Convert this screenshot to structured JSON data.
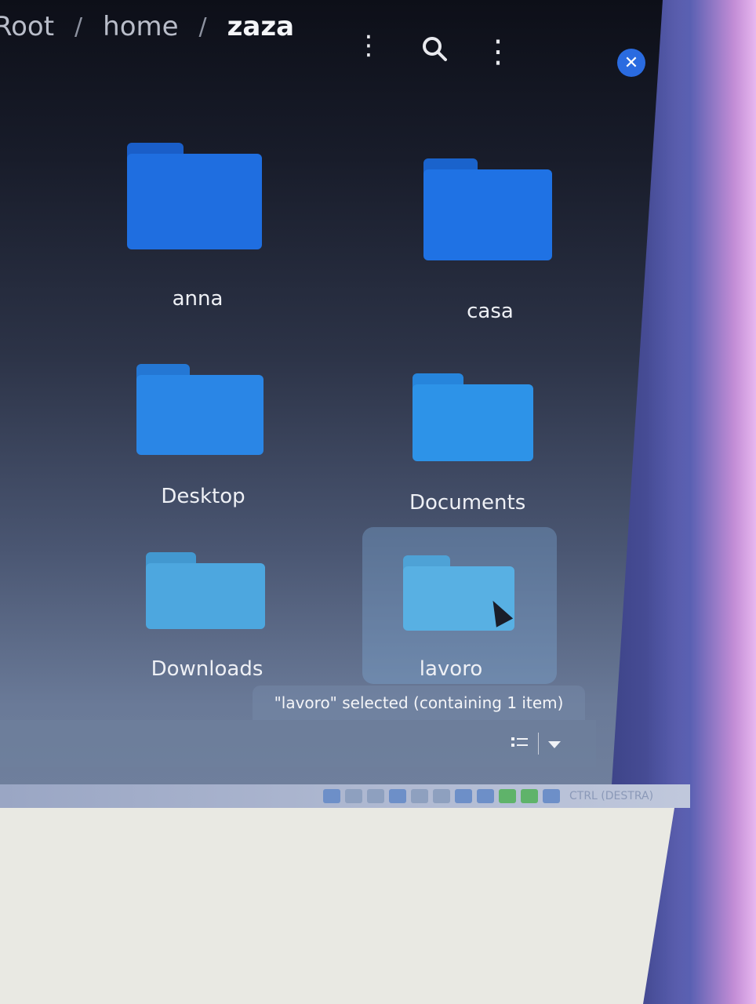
{
  "breadcrumb": {
    "root": "Root",
    "home": "home",
    "current": "zaza",
    "separator": "/"
  },
  "header": {
    "menu_icon": "⋮",
    "search_icon": "⌕",
    "more_icon": "⋮",
    "close_icon": "✕"
  },
  "folders": [
    {
      "label": "anna",
      "color": "#1f6ee0"
    },
    {
      "label": "casa",
      "color": "#1f72e4"
    },
    {
      "label": "Desktop",
      "color": "#2a86e6"
    },
    {
      "label": "Documents",
      "color": "#2d93e8"
    },
    {
      "label": "Downloads",
      "color": "#4da7df"
    },
    {
      "label": "lavoro",
      "color": "#58b0e3"
    }
  ],
  "selected_folder": "lavoro",
  "status_text": "\"lavoro\" selected  (containing 1 item)",
  "view_toggle": {
    "list_icon": "list-view-icon",
    "dropdown_icon": "chevron-down-icon"
  },
  "tray": {
    "label": "CTRL (DESTRA)"
  },
  "colors": {
    "accent": "#2a6be0",
    "selection": "#82afdc"
  }
}
